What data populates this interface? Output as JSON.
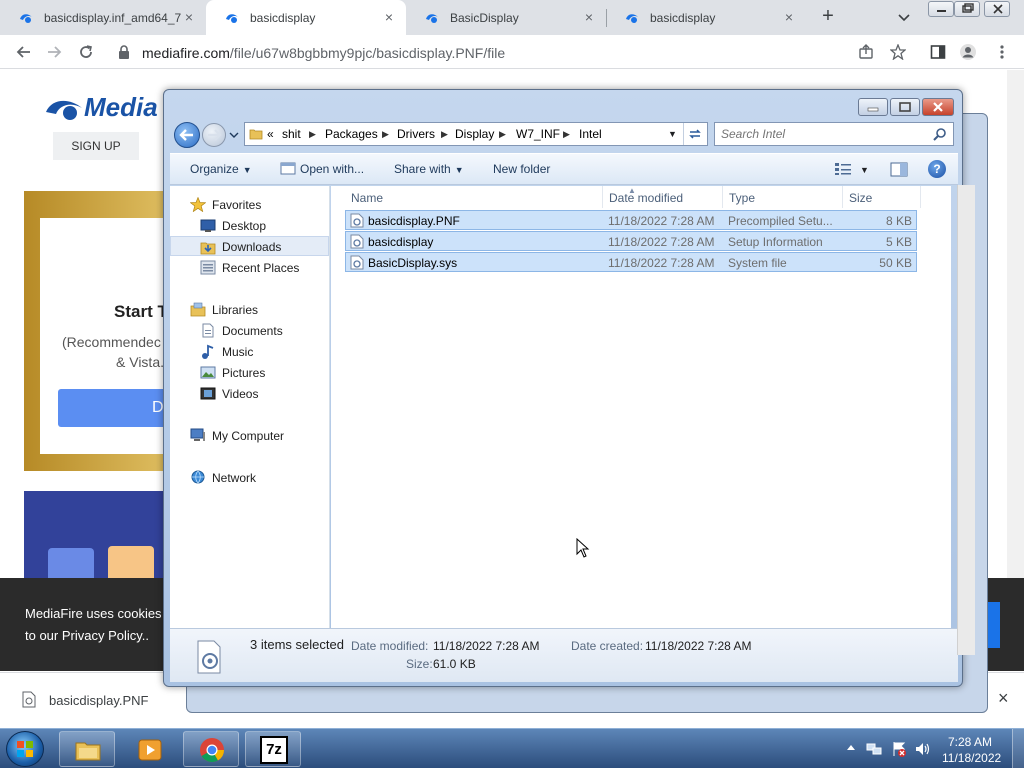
{
  "browser": {
    "tabs": [
      {
        "title": "basicdisplay.inf_amd64_7",
        "active": false
      },
      {
        "title": "basicdisplay",
        "active": true
      },
      {
        "title": "BasicDisplay",
        "active": false
      },
      {
        "title": "basicdisplay",
        "active": false
      }
    ],
    "url_host": "mediafire.com",
    "url_path": "/file/u67w8bgbbmy9pjc/basicdisplay.PNF/file"
  },
  "page": {
    "logo": "Media",
    "signup": "SIGN UP",
    "start_text": "Start T",
    "recommend_line1": "(Recommendec",
    "recommend_line2": "& Vista.",
    "download_btn": "D",
    "cookie_line1": "MediaFire uses cookies",
    "cookie_line2": "to our Privacy Policy.."
  },
  "download_bar": {
    "file": "basicdisplay.PNF"
  },
  "explorer": {
    "breadcrumb": [
      "«",
      "shit",
      "Packages",
      "Drivers",
      "Display",
      "W7_INF",
      "Intel"
    ],
    "search_placeholder": "Search Intel",
    "commands": {
      "organize": "Organize",
      "open_with": "Open with...",
      "share_with": "Share with",
      "new_folder": "New folder"
    },
    "nav": {
      "favorites": "Favorites",
      "desktop": "Desktop",
      "downloads": "Downloads",
      "recent": "Recent Places",
      "libraries": "Libraries",
      "documents": "Documents",
      "music": "Music",
      "pictures": "Pictures",
      "videos": "Videos",
      "computer": "My Computer",
      "network": "Network"
    },
    "columns": {
      "name": "Name",
      "date": "Date modified",
      "type": "Type",
      "size": "Size"
    },
    "files": [
      {
        "name": "basicdisplay.PNF",
        "date": "11/18/2022 7:28 AM",
        "type": "Precompiled Setu...",
        "size": "8 KB"
      },
      {
        "name": "basicdisplay",
        "date": "11/18/2022 7:28 AM",
        "type": "Setup Information",
        "size": "5 KB"
      },
      {
        "name": "BasicDisplay.sys",
        "date": "11/18/2022 7:28 AM",
        "type": "System file",
        "size": "50 KB"
      }
    ],
    "details": {
      "selected": "3 items selected",
      "date_modified_label": "Date modified:",
      "date_modified": "11/18/2022 7:28 AM",
      "date_created_label": "Date created:",
      "date_created": "11/18/2022 7:28 AM",
      "size_label": "Size:",
      "size": "61.0 KB"
    }
  },
  "taskbar": {
    "time": "7:28 AM",
    "date": "11/18/2022",
    "sevenzip_label": "7z"
  },
  "colors": {
    "selection": "#cce2fa",
    "chrome_tabbar": "#dee1e6",
    "taskbar": "#2c4d7c"
  }
}
